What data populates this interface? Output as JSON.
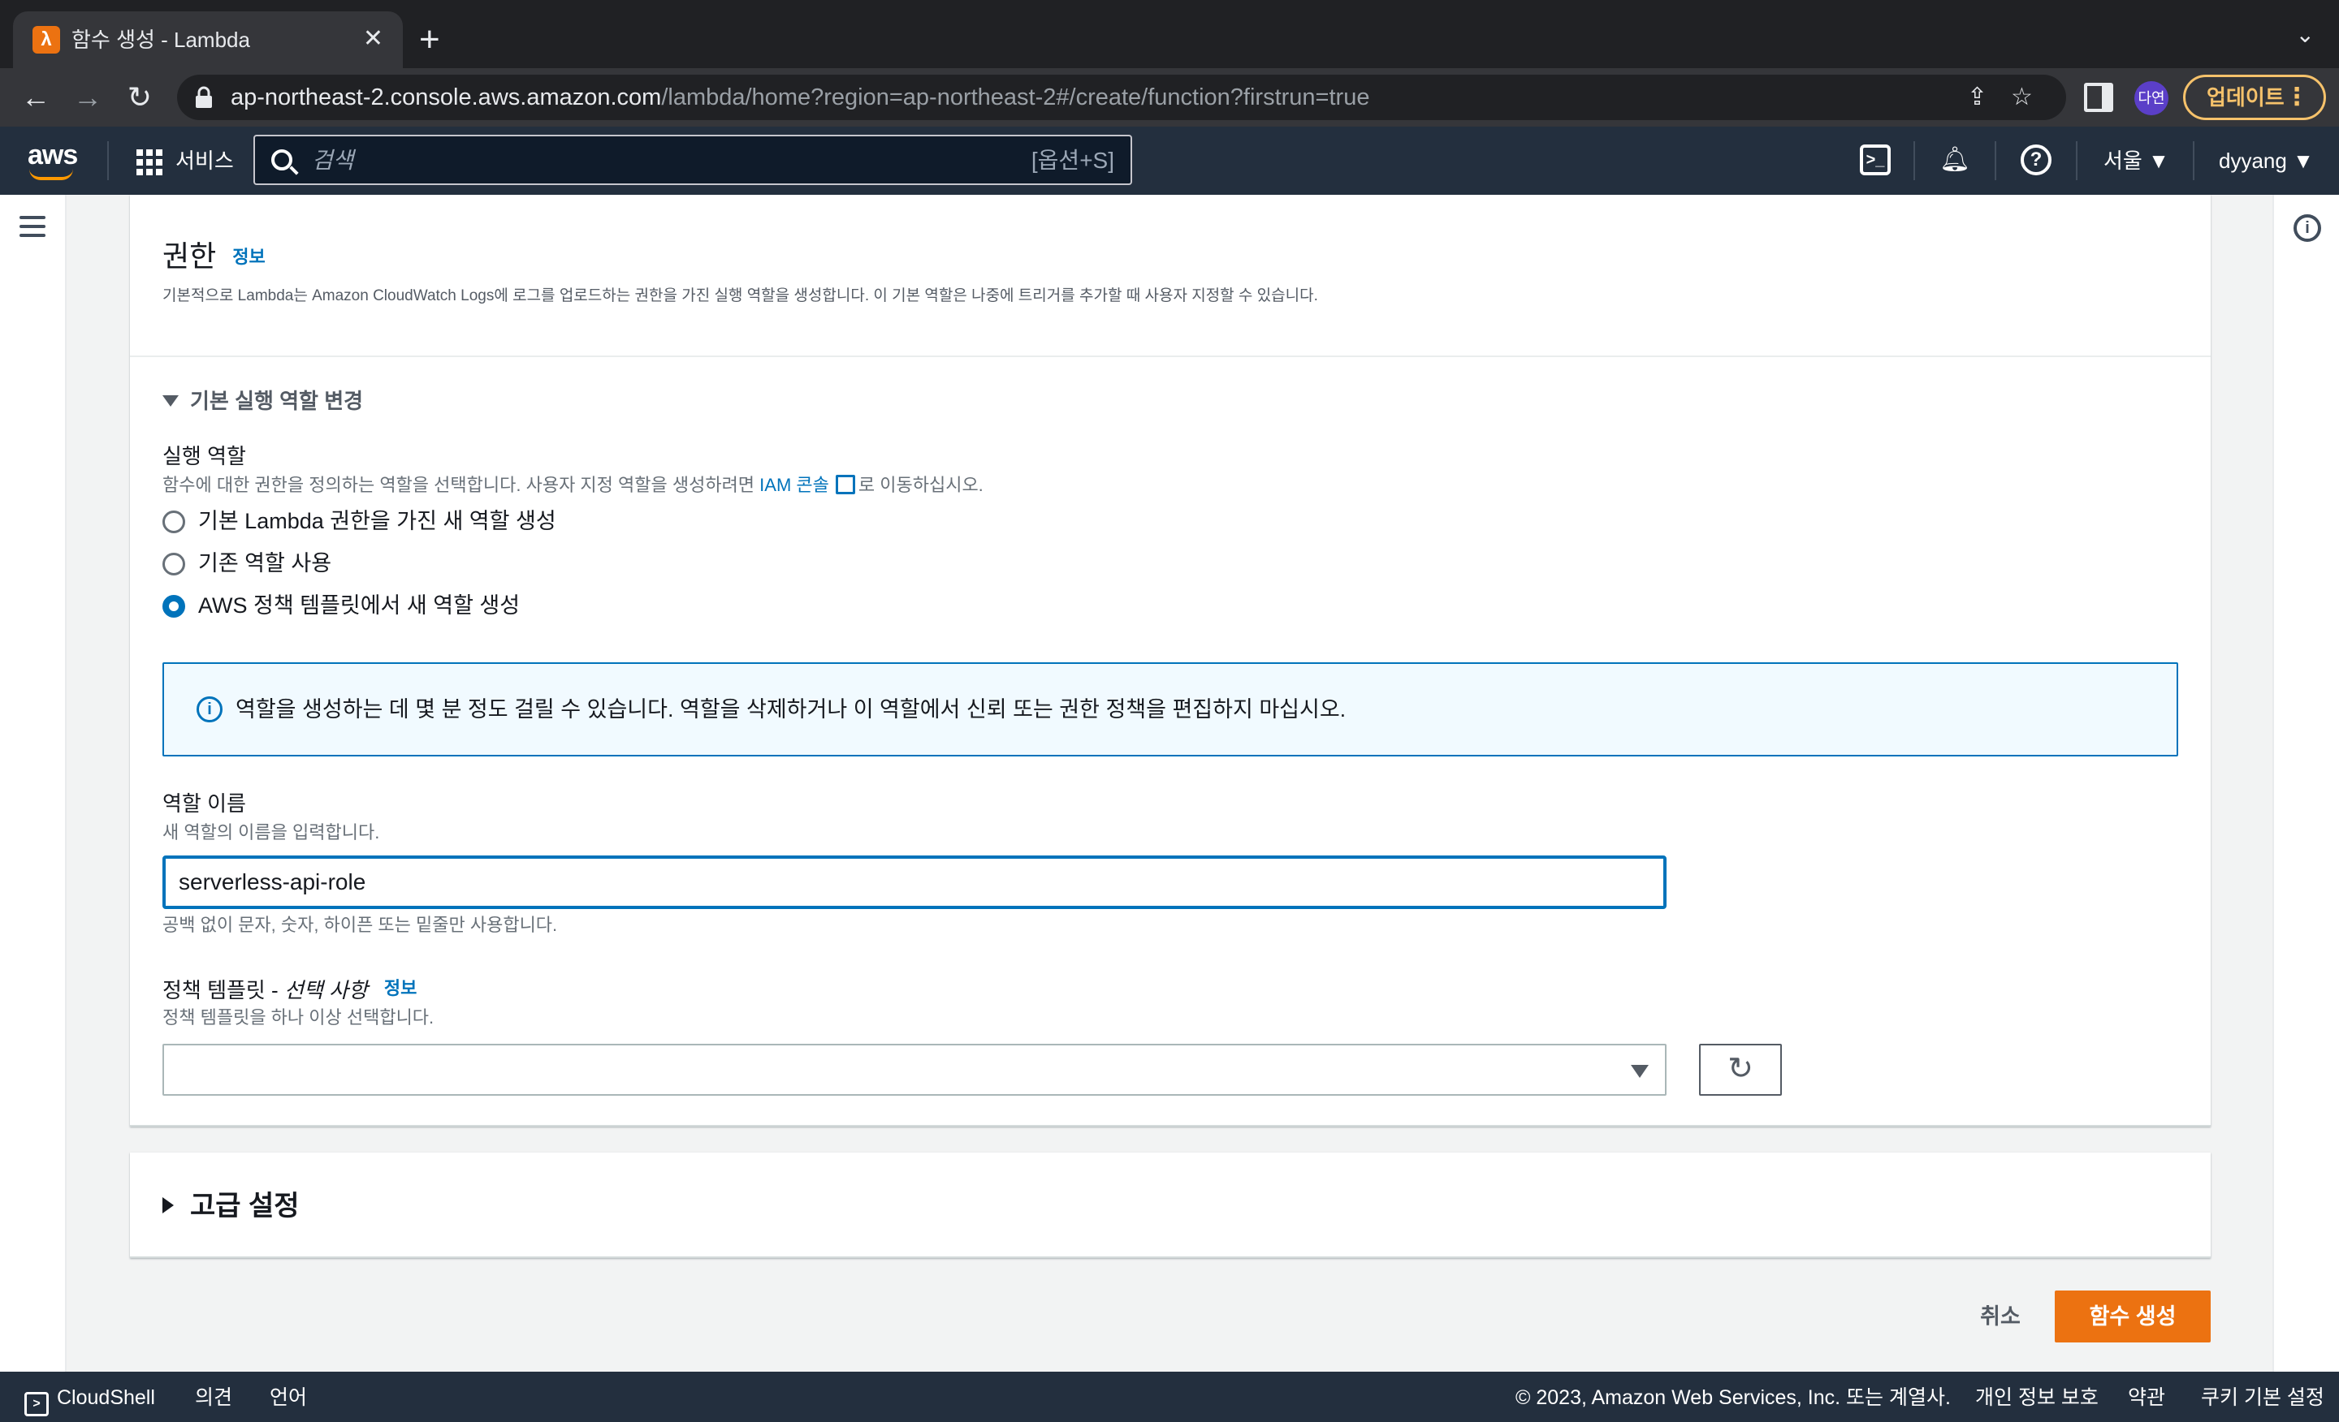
{
  "browser": {
    "tab_title": "함수 생성 - Lambda",
    "tab_close": "✕",
    "new_tab": "+",
    "url_host": "ap-northeast-2.console.aws.amazon.com",
    "url_path": "/lambda/home?region=ap-northeast-2#/create/function?firstrun=true",
    "profile_label": "다연",
    "update_label": "업데이트",
    "update_menu": "⋮"
  },
  "awsnav": {
    "logo": "aws",
    "services_label": "서비스",
    "search_placeholder": "검색",
    "search_shortcut": "[옵션+S]",
    "region": "서울 ▼",
    "user": "dyyang ▼"
  },
  "permissions": {
    "title": "권한",
    "info_label": "정보",
    "description": "기본적으로 Lambda는 Amazon CloudWatch Logs에 로그를 업로드하는 권한을 가진 실행 역할을 생성합니다. 이 기본 역할은 나중에 트리거를 추가할 때 사용자 지정할 수 있습니다.",
    "expander_label": "기본 실행 역할 변경",
    "execution_role": {
      "label": "실행 역할",
      "desc_before": "함수에 대한 권한을 정의하는 역할을 선택합니다. 사용자 지정 역할을 생성하려면 ",
      "desc_link": "IAM 콘솔",
      "desc_after": "로 이동하십시오.",
      "options": [
        {
          "label": "기본 Lambda 권한을 가진 새 역할 생성",
          "checked": false
        },
        {
          "label": "기존 역할 사용",
          "checked": false
        },
        {
          "label": "AWS 정책 템플릿에서 새 역할 생성",
          "checked": true
        }
      ]
    },
    "alert_text": "역할을 생성하는 데 몇 분 정도 걸릴 수 있습니다. 역할을 삭제하거나 이 역할에서 신뢰 또는 권한 정책을 편집하지 마십시오.",
    "role_name": {
      "label": "역할 이름",
      "desc": "새 역할의 이름을 입력합니다.",
      "value": "serverless-api-role",
      "hint": "공백 없이 문자, 숫자, 하이픈 또는 밑줄만 사용합니다."
    },
    "policy_template": {
      "label": "정책 템플릿 - ",
      "label_optional": "선택 사항",
      "info_label": "정보",
      "desc": "정책 템플릿을 하나 이상 선택합니다.",
      "selected": ""
    }
  },
  "advanced": {
    "title": "고급 설정"
  },
  "actions": {
    "cancel": "취소",
    "create": "함수 생성"
  },
  "footer": {
    "cloudshell": "CloudShell",
    "feedback": "의견",
    "language": "언어",
    "copyright": "© 2023, Amazon Web Services, Inc. 또는 계열사.",
    "privacy": "개인 정보 보호",
    "terms": "약관",
    "cookies": "쿠키 기본 설정"
  },
  "colors": {
    "accent": "#0073bb",
    "primary_button": "#ec7211",
    "nav_bg": "#232f3e"
  }
}
